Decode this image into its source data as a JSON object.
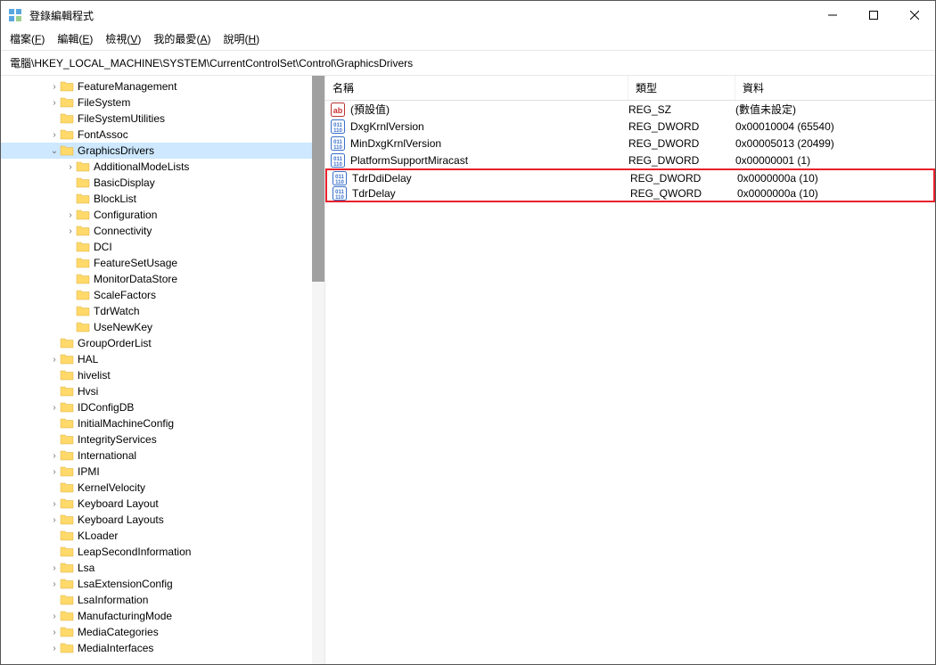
{
  "window": {
    "title": "登錄編輯程式"
  },
  "menu": {
    "file": "檔案",
    "file_k": "F",
    "edit": "編輯",
    "edit_k": "E",
    "view": "檢視",
    "view_k": "V",
    "fav": "我的最愛",
    "fav_k": "A",
    "help": "說明",
    "help_k": "H"
  },
  "address": "電腦\\HKEY_LOCAL_MACHINE\\SYSTEM\\CurrentControlSet\\Control\\GraphicsDrivers",
  "columns": {
    "name": "名稱",
    "type": "類型",
    "data": "資料"
  },
  "tree": [
    {
      "indent": 3,
      "exp": ">",
      "label": "FeatureManagement"
    },
    {
      "indent": 3,
      "exp": ">",
      "label": "FileSystem"
    },
    {
      "indent": 3,
      "exp": "",
      "label": "FileSystemUtilities"
    },
    {
      "indent": 3,
      "exp": ">",
      "label": "FontAssoc"
    },
    {
      "indent": 3,
      "exp": "v",
      "label": "GraphicsDrivers",
      "selected": true
    },
    {
      "indent": 4,
      "exp": ">",
      "label": "AdditionalModeLists"
    },
    {
      "indent": 4,
      "exp": "",
      "label": "BasicDisplay"
    },
    {
      "indent": 4,
      "exp": "",
      "label": "BlockList"
    },
    {
      "indent": 4,
      "exp": ">",
      "label": "Configuration"
    },
    {
      "indent": 4,
      "exp": ">",
      "label": "Connectivity"
    },
    {
      "indent": 4,
      "exp": "",
      "label": "DCI"
    },
    {
      "indent": 4,
      "exp": "",
      "label": "FeatureSetUsage"
    },
    {
      "indent": 4,
      "exp": "",
      "label": "MonitorDataStore"
    },
    {
      "indent": 4,
      "exp": "",
      "label": "ScaleFactors"
    },
    {
      "indent": 4,
      "exp": "",
      "label": "TdrWatch"
    },
    {
      "indent": 4,
      "exp": "",
      "label": "UseNewKey"
    },
    {
      "indent": 3,
      "exp": "",
      "label": "GroupOrderList"
    },
    {
      "indent": 3,
      "exp": ">",
      "label": "HAL"
    },
    {
      "indent": 3,
      "exp": "",
      "label": "hivelist"
    },
    {
      "indent": 3,
      "exp": "",
      "label": "Hvsi"
    },
    {
      "indent": 3,
      "exp": ">",
      "label": "IDConfigDB"
    },
    {
      "indent": 3,
      "exp": "",
      "label": "InitialMachineConfig"
    },
    {
      "indent": 3,
      "exp": "",
      "label": "IntegrityServices"
    },
    {
      "indent": 3,
      "exp": ">",
      "label": "International"
    },
    {
      "indent": 3,
      "exp": ">",
      "label": "IPMI"
    },
    {
      "indent": 3,
      "exp": "",
      "label": "KernelVelocity"
    },
    {
      "indent": 3,
      "exp": ">",
      "label": "Keyboard Layout"
    },
    {
      "indent": 3,
      "exp": ">",
      "label": "Keyboard Layouts"
    },
    {
      "indent": 3,
      "exp": "",
      "label": "KLoader"
    },
    {
      "indent": 3,
      "exp": "",
      "label": "LeapSecondInformation"
    },
    {
      "indent": 3,
      "exp": ">",
      "label": "Lsa"
    },
    {
      "indent": 3,
      "exp": ">",
      "label": "LsaExtensionConfig"
    },
    {
      "indent": 3,
      "exp": "",
      "label": "LsaInformation"
    },
    {
      "indent": 3,
      "exp": ">",
      "label": "ManufacturingMode"
    },
    {
      "indent": 3,
      "exp": ">",
      "label": "MediaCategories"
    },
    {
      "indent": 3,
      "exp": ">",
      "label": "MediaInterfaces"
    }
  ],
  "values": [
    {
      "icon": "str",
      "name": "(預設值)",
      "type": "REG_SZ",
      "data": "(數值未設定)"
    },
    {
      "icon": "bin",
      "name": "DxgKrnlVersion",
      "type": "REG_DWORD",
      "data": "0x00010004 (65540)"
    },
    {
      "icon": "bin",
      "name": "MinDxgKrnlVersion",
      "type": "REG_DWORD",
      "data": "0x00005013 (20499)"
    },
    {
      "icon": "bin",
      "name": "PlatformSupportMiracast",
      "type": "REG_DWORD",
      "data": "0x00000001 (1)"
    },
    {
      "icon": "bin",
      "name": "TdrDdiDelay",
      "type": "REG_DWORD",
      "data": "0x0000000a (10)",
      "hl": "first"
    },
    {
      "icon": "bin",
      "name": "TdrDelay",
      "type": "REG_QWORD",
      "data": "0x0000000a (10)",
      "hl": "last"
    }
  ]
}
